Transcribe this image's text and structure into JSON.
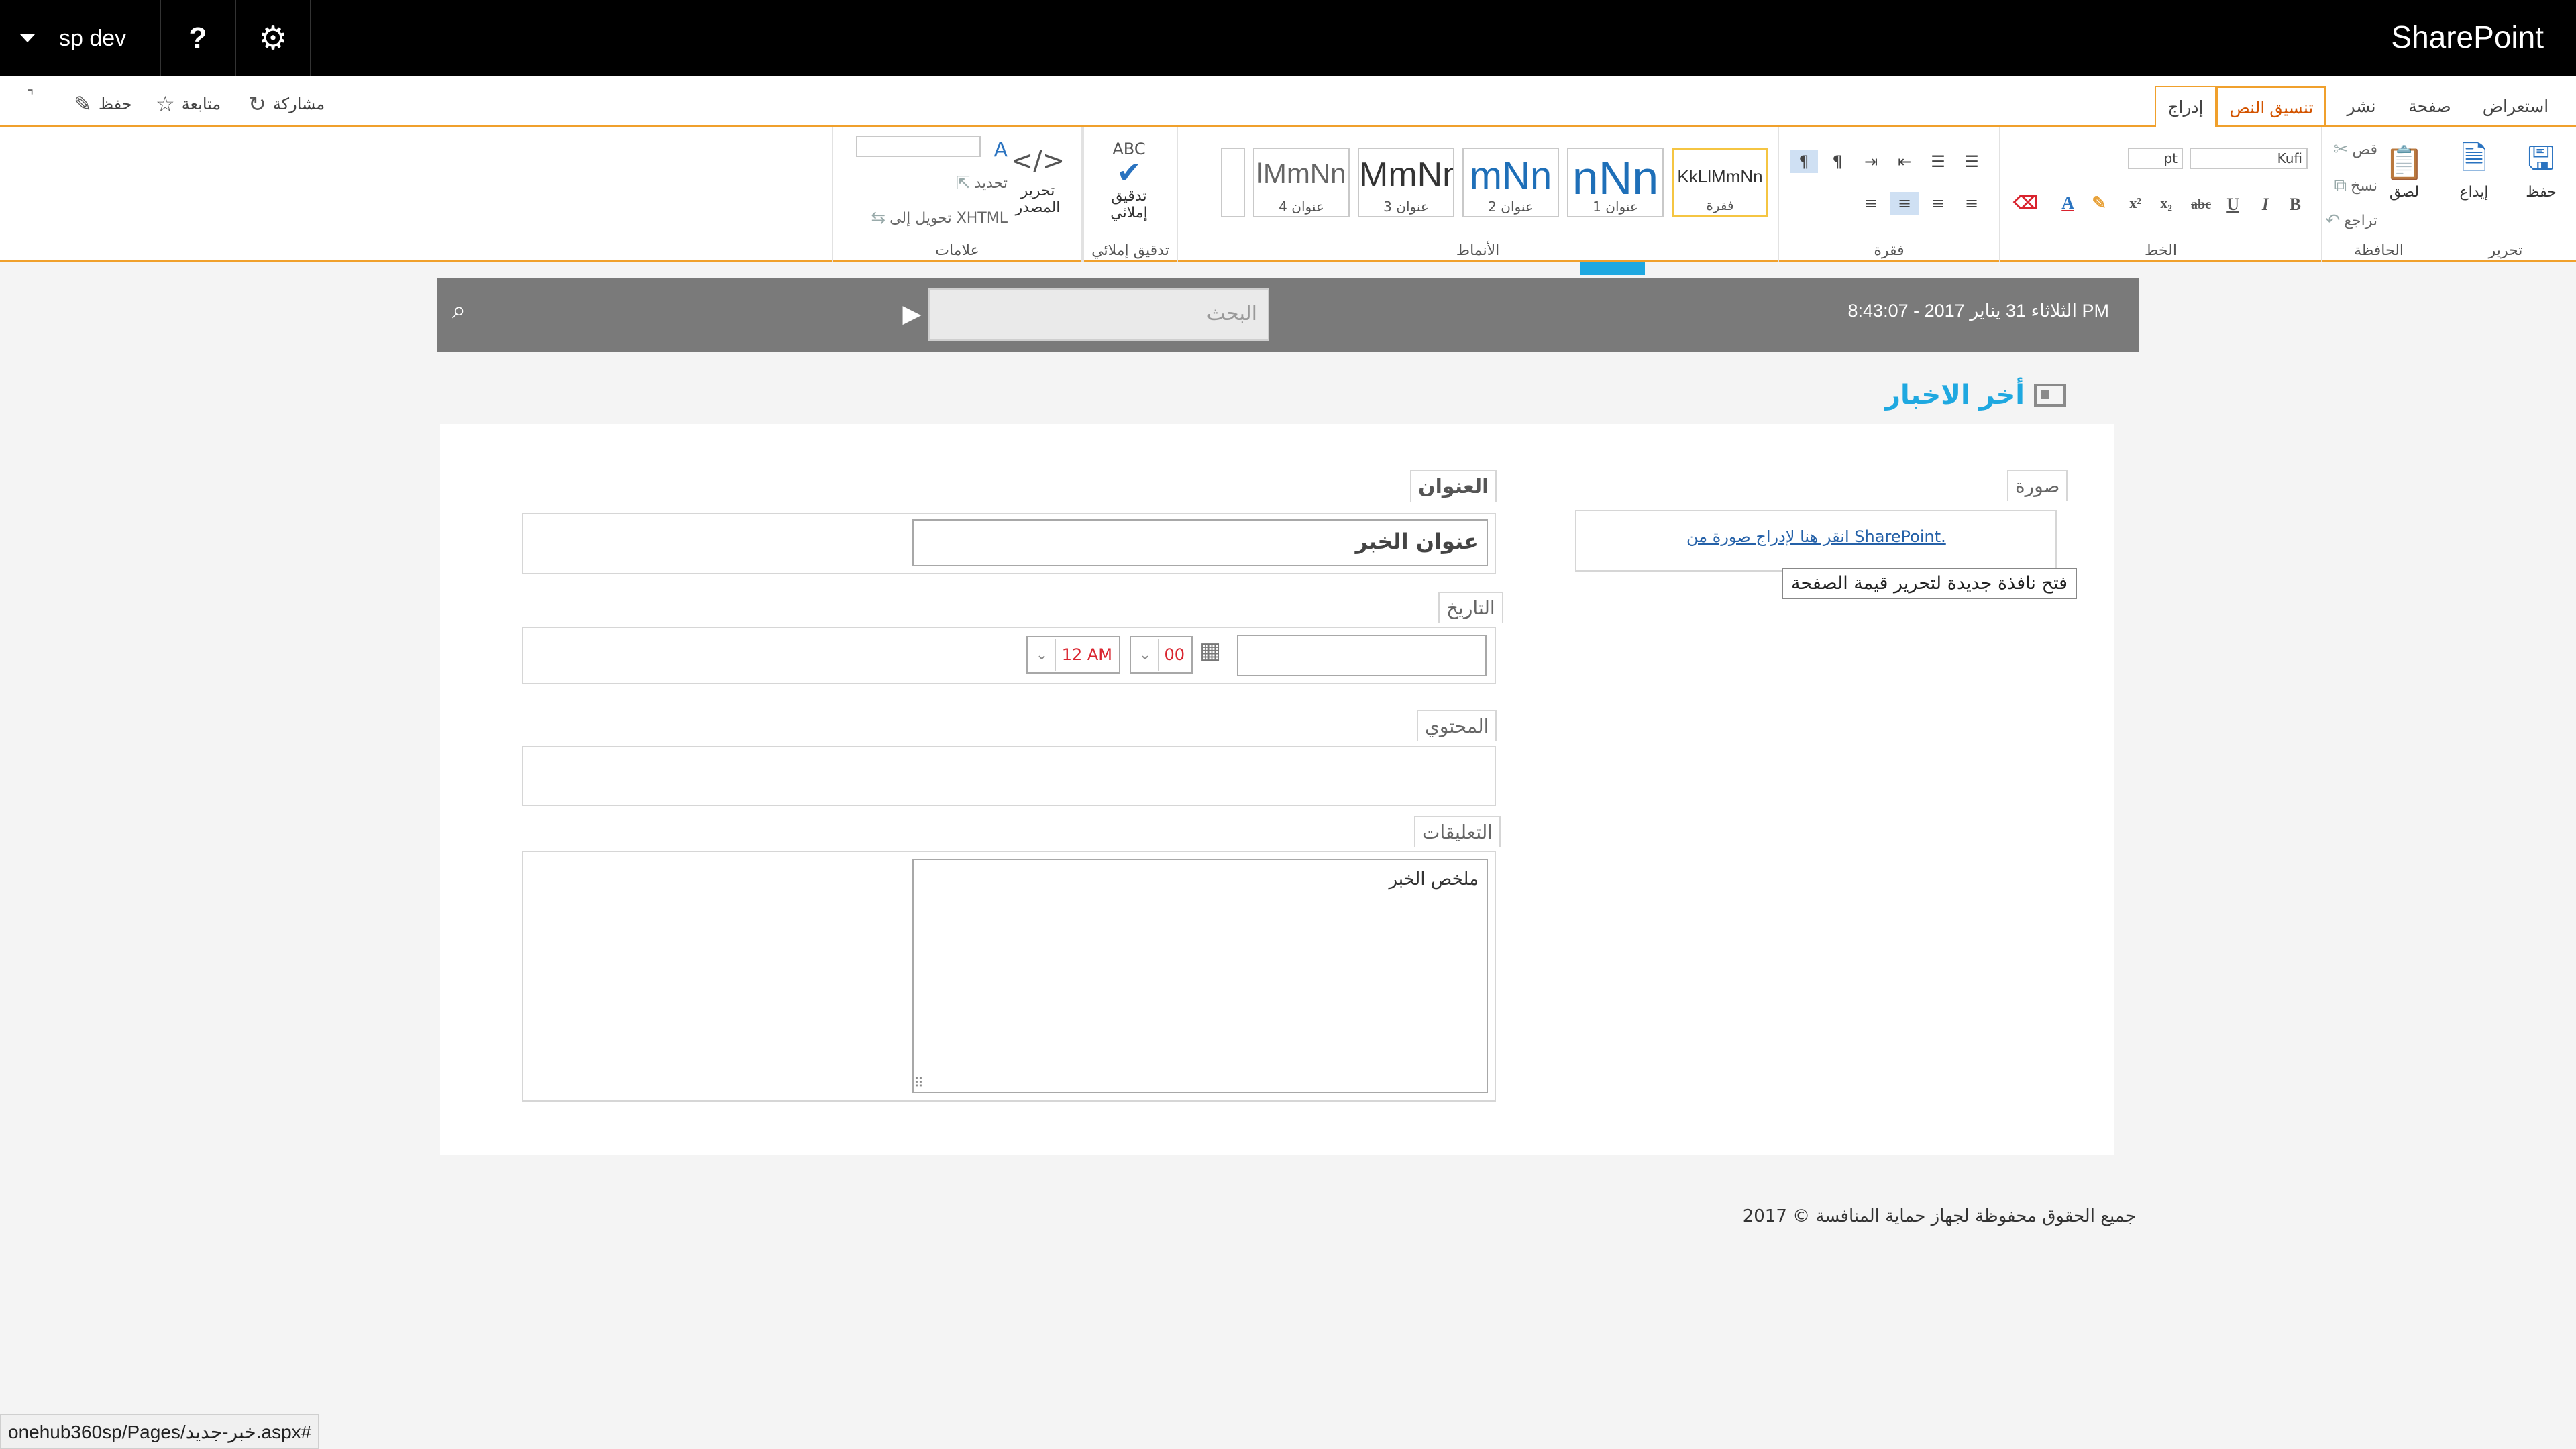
{
  "suitebar": {
    "brand": "SharePoint",
    "site_name": "sp dev",
    "help": "?"
  },
  "ribbon_tabs": {
    "browse": "استعراض",
    "page": "صفحة",
    "publish": "نشر",
    "format_text": "تنسيق النص",
    "insert": "إدراج"
  },
  "page_actions": {
    "share": "مشاركة",
    "follow": "متابعة",
    "save": "حفظ"
  },
  "ribbon": {
    "edit_group": "تحرير",
    "save": "حفظ",
    "checkin": "إيداع",
    "clipboard_group": "الحافظة",
    "paste": "لصق",
    "cut": "قص",
    "copy": "نسخ",
    "undo": "تراجع",
    "font_group": "الخط",
    "font_name": "Kufi",
    "font_size": "pt",
    "paragraph_group": "فقرة",
    "styles_group": "الأنماط",
    "styles": [
      {
        "sample": "KkLlMmNn",
        "label": "فقرة"
      },
      {
        "sample": "nNn",
        "label": "عنوان 1"
      },
      {
        "sample": "mNn",
        "label": "عنوان 2"
      },
      {
        "sample": "MmNn",
        "label": "عنوان 3"
      },
      {
        "sample": "lMmNn",
        "label": "عنوان 4"
      }
    ],
    "spelling_group": "تدقيق إملائي",
    "spelling_top": "ABC",
    "spelling": "تدقيق إملائي",
    "markup_group": "علامات",
    "edit_source": "تحرير المصدر",
    "select": "تحديد",
    "convert_xhtml": "تحويل إلى XHTML"
  },
  "banner": {
    "datetime": "الثلاثاء 31 يناير 2017 - 8:43:07 PM",
    "search_placeholder": "البحث"
  },
  "page_title": "أخر الاخبار",
  "form": {
    "image_label": "صورة",
    "image_link": "انقر هنا لإدراج صورة من SharePoint.",
    "image_tooltip": "فتح نافذة جديدة لتحرير قيمة الصفحة",
    "title_label": "العنوان",
    "title_value": "عنوان الخبر",
    "date_label": "التاريخ",
    "date_value": "",
    "minutes_value": "00",
    "hour_value": "12 AM",
    "content_label": "المحتوي",
    "comments_label": "التعليقات",
    "comments_value": "ملخص الخبر"
  },
  "footer": "جميع الحقوق محفوظة لجهاز حماية المنافسة © 2017",
  "status_bar": "onehub360sp/Pages/خبر-جديد.aspx#"
}
